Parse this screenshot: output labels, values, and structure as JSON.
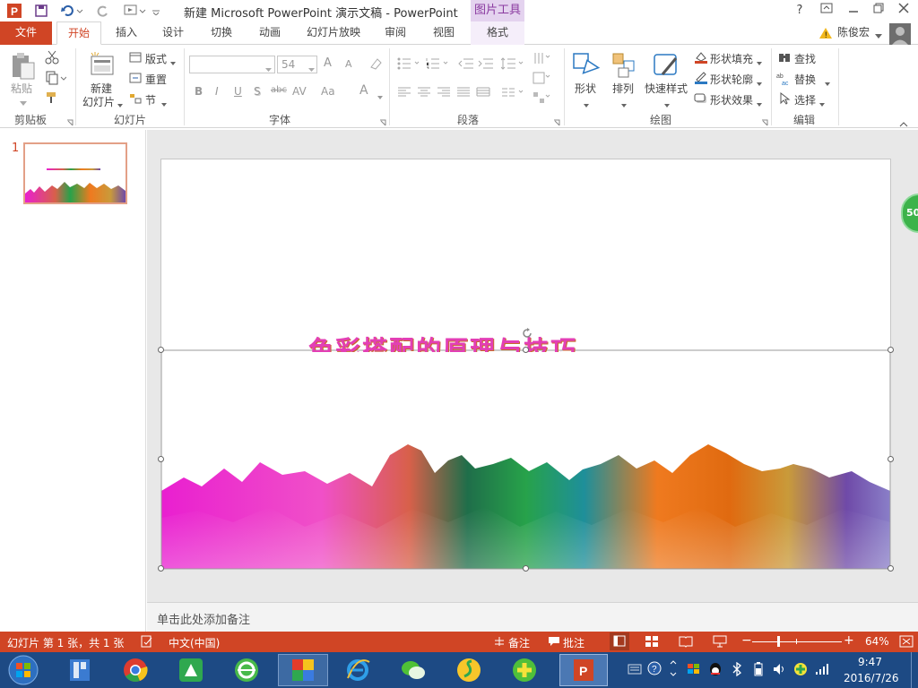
{
  "titlebar": {
    "title": "新建 Microsoft PowerPoint 演示文稿 - PowerPoint",
    "contextual_tab": "图片工具",
    "help": "?"
  },
  "tabs": [
    "文件",
    "开始",
    "插入",
    "设计",
    "切换",
    "动画",
    "幻灯片放映",
    "审阅",
    "视图",
    "格式"
  ],
  "user": {
    "name": "陈俊宏"
  },
  "ribbon": {
    "clipboard": {
      "group": "剪贴板",
      "paste": "粘贴"
    },
    "slides": {
      "group": "幻灯片",
      "new_slide_1": "新建",
      "new_slide_2": "幻灯片",
      "layout": "版式",
      "reset": "重置",
      "section": "节"
    },
    "font": {
      "group": "字体",
      "font_size": "54",
      "bold": "B",
      "italic": "I",
      "underline": "U",
      "shadow": "S",
      "strike": "abc",
      "spacing": "AV",
      "case": "Aa",
      "grow": "A",
      "shrink": "A",
      "color": "A"
    },
    "paragraph": {
      "group": "段落"
    },
    "drawing": {
      "group": "绘图",
      "shape": "形状",
      "arrange": "排列",
      "quick_style": "快速样式",
      "fill": "形状填充",
      "outline": "形状轮廓",
      "effects": "形状效果"
    },
    "editing": {
      "group": "编辑",
      "find": "查找",
      "replace": "替换",
      "select": "选择"
    }
  },
  "slides_pane": {
    "slide_number": "1"
  },
  "slide": {
    "title_text": "色彩搭配的原理与技巧"
  },
  "notes": {
    "placeholder": "单击此处添加备注"
  },
  "floating_badge": {
    "text": "50"
  },
  "statusbar": {
    "slide_info": "幻灯片 第 1 张，共 1 张",
    "language": "中文(中国)",
    "notes_btn": "备注",
    "comments_btn": "批注",
    "zoom": "64%"
  },
  "taskbar": {
    "time": "9:47",
    "date": "2016/7/26"
  },
  "colors": {
    "accent": "#d04525",
    "picture_tools": "#e4d3ef",
    "taskbar": "#1d4a84"
  }
}
